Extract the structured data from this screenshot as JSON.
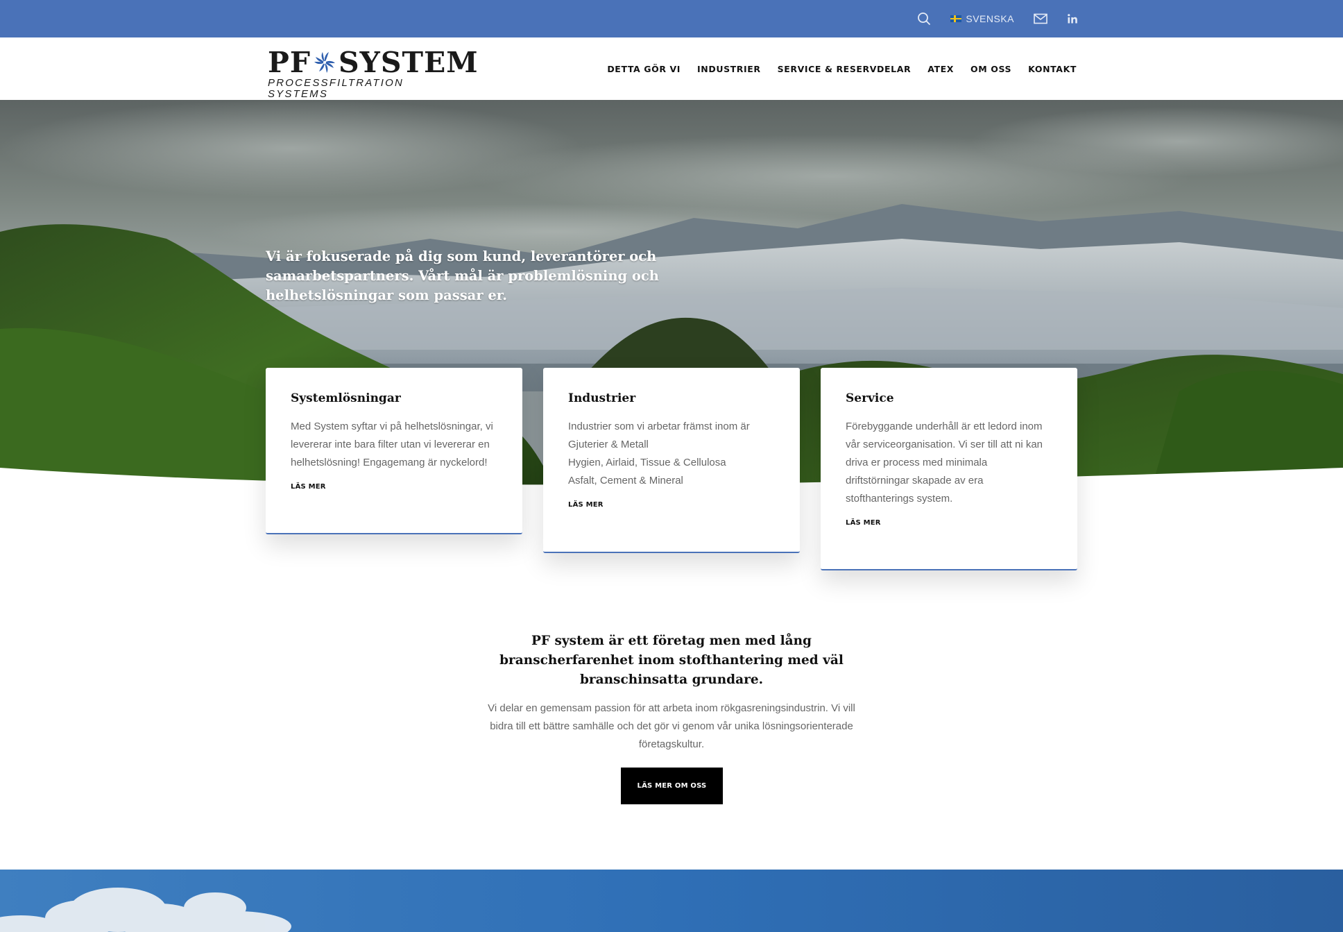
{
  "topbar": {
    "language": "SVENSKA",
    "icons": [
      "search-icon",
      "flag-sweden-icon",
      "mail-icon",
      "linkedin-icon"
    ],
    "background_color": "#4a72b8"
  },
  "logo": {
    "name": "PF SYSTEM",
    "tagline": "PROCESSFILTRATION SYSTEMS"
  },
  "nav": {
    "items": [
      {
        "label": "DETTA GÖR VI"
      },
      {
        "label": "INDUSTRIER"
      },
      {
        "label": "SERVICE & RESERVDELAR"
      },
      {
        "label": "ATEX"
      },
      {
        "label": "OM OSS"
      },
      {
        "label": "KONTAKT"
      }
    ]
  },
  "hero": {
    "text": "Vi är fokuserade på dig som kund, leverantörer och samarbetspartners. Vårt mål är problemlösning och helhetslösningar som passar er."
  },
  "cards": [
    {
      "title": "Systemlösningar",
      "body": "Med System syftar vi på helhetslösningar, vi levererar inte bara filter utan vi levererar en helhetslösning! Engagemang är nyckelord!",
      "link": "LÄS MER"
    },
    {
      "title": "Industrier",
      "lines": [
        "Industrier som vi arbetar främst inom är",
        "Gjuterier & Metall",
        "Hygien, Airlaid, Tissue & Cellulosa",
        "Asfalt, Cement & Mineral"
      ],
      "link": "LÄS MER"
    },
    {
      "title": "Service",
      "body": "Förebyggande underhåll är ett ledord inom vår serviceorganisation. Vi ser till att ni kan driva er process med minimala driftstörningar skapade av era stofthanterings system.",
      "link": "LÄS MER"
    }
  ],
  "about": {
    "heading": "PF system är ett företag men med lång branscherfarenhet inom stofthantering med väl branschinsatta grundare.",
    "body": "Vi delar en gemensam passion för att arbeta inom rökgasreningsindustrin. Vi vill bidra till ett bättre samhälle och det gör vi genom vår unika lösningsorienterade företagskultur.",
    "button": "LÄS MER OM OSS"
  },
  "colors": {
    "accent": "#4a72b8",
    "button_bg": "#000000",
    "body_text": "#666666"
  }
}
